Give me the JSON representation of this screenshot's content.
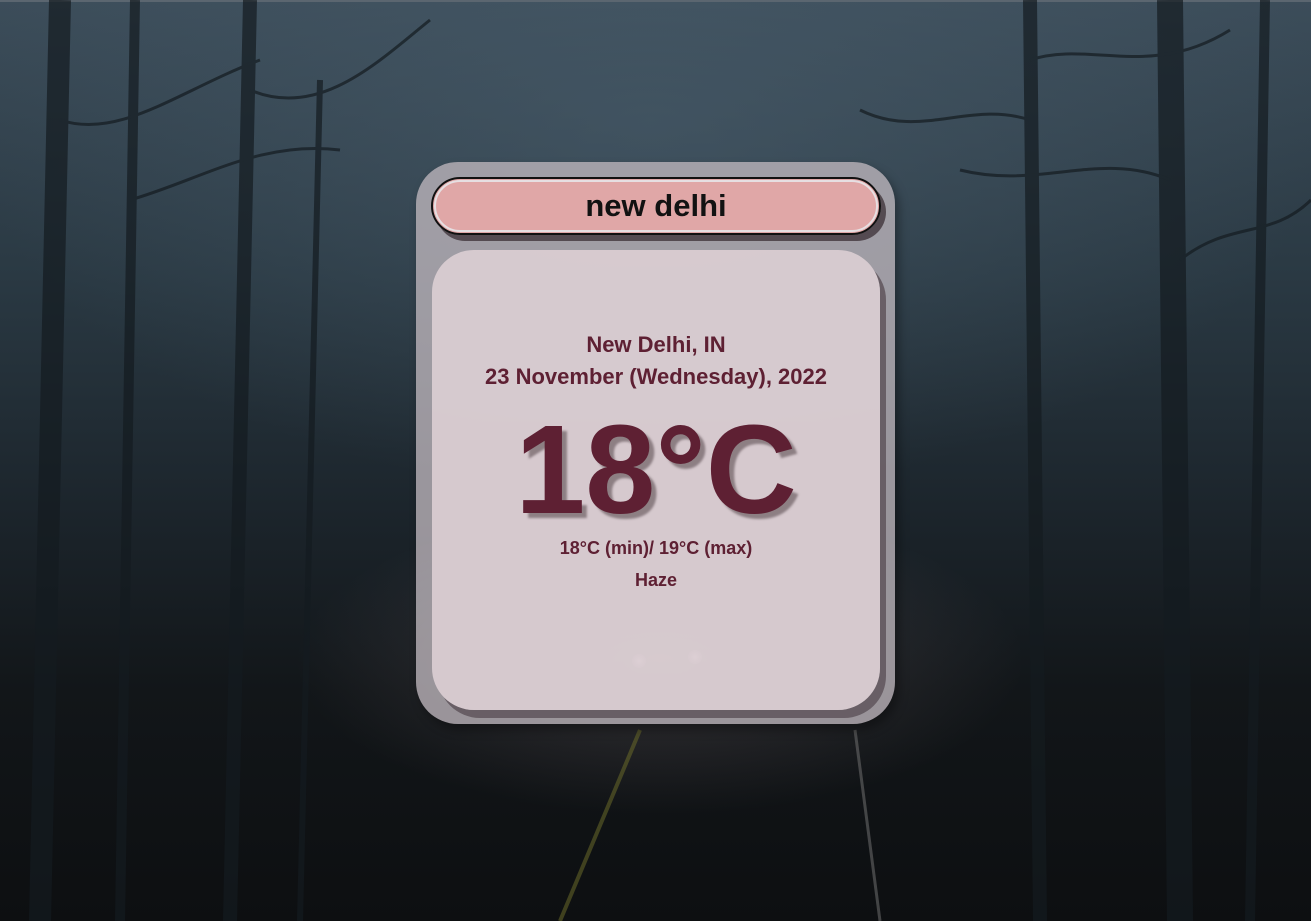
{
  "search": {
    "value": "new delhi",
    "placeholder": ""
  },
  "weather": {
    "location": "New Delhi, IN",
    "date": "23 November (Wednesday), 2022",
    "temperature": "18°C",
    "min_max": "18°C (min)/ 19°C (max)",
    "condition": "Haze"
  },
  "colors": {
    "text_accent": "#5e2033",
    "search_background": "#e0a7a7",
    "panel_background": "#e0d2d6"
  }
}
